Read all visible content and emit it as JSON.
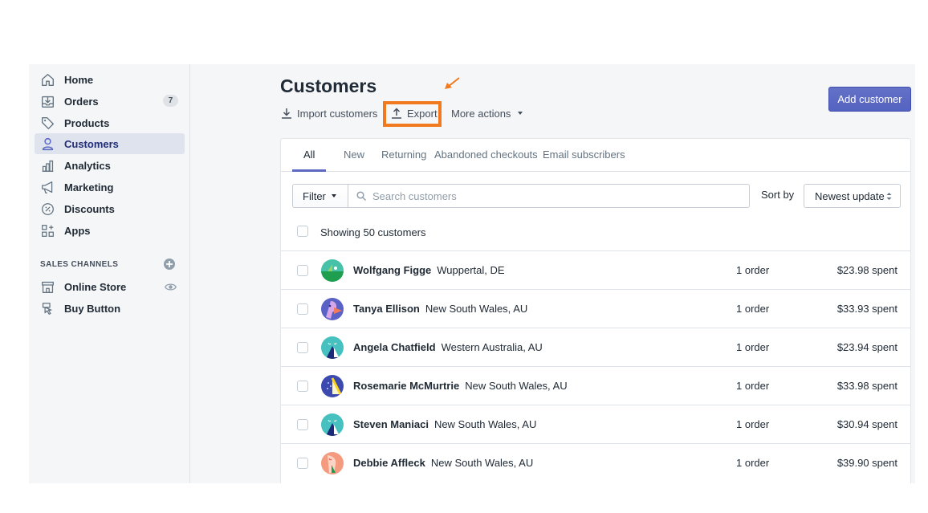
{
  "sidebar": {
    "items": [
      {
        "label": "Home",
        "icon": "home-icon"
      },
      {
        "label": "Orders",
        "icon": "orders-icon",
        "badge": "7"
      },
      {
        "label": "Products",
        "icon": "tag-icon"
      },
      {
        "label": "Customers",
        "icon": "person-icon",
        "active": true
      },
      {
        "label": "Analytics",
        "icon": "bar-chart-icon"
      },
      {
        "label": "Marketing",
        "icon": "megaphone-icon"
      },
      {
        "label": "Discounts",
        "icon": "discount-icon"
      },
      {
        "label": "Apps",
        "icon": "apps-icon"
      }
    ],
    "sales_channels_heading": "SALES CHANNELS",
    "channels": [
      {
        "label": "Online Store",
        "icon": "store-icon"
      },
      {
        "label": "Buy Button",
        "icon": "buy-button-icon"
      }
    ]
  },
  "header": {
    "title": "Customers",
    "import_label": "Import customers",
    "export_label": "Export",
    "more_actions_label": "More actions",
    "add_customer_label": "Add customer"
  },
  "tabs": [
    "All",
    "New",
    "Returning",
    "Abandoned checkouts",
    "Email subscribers"
  ],
  "filter": {
    "filter_label": "Filter",
    "search_placeholder": "Search customers",
    "sort_label": "Sort by",
    "sort_value": "Newest update"
  },
  "showing_text": "Showing 50 customers",
  "customers": [
    {
      "name": "Wolfgang Figge",
      "location": "Wuppertal, DE",
      "orders": "1 order",
      "spent": "$23.98 spent"
    },
    {
      "name": "Tanya Ellison",
      "location": "New South Wales, AU",
      "orders": "1 order",
      "spent": "$33.93 spent"
    },
    {
      "name": "Angela Chatfield",
      "location": "Western Australia, AU",
      "orders": "1 order",
      "spent": "$23.94 spent"
    },
    {
      "name": "Rosemarie McMurtrie",
      "location": "New South Wales, AU",
      "orders": "1 order",
      "spent": "$33.98 spent"
    },
    {
      "name": "Steven Maniaci",
      "location": "New South Wales, AU",
      "orders": "1 order",
      "spent": "$30.94 spent"
    },
    {
      "name": "Debbie Affleck",
      "location": "New South Wales, AU",
      "orders": "1 order",
      "spent": "$39.90 spent"
    }
  ],
  "colors": {
    "accent": "#5c6ac4",
    "highlight": "#f27a1e",
    "sidebar_active": "#dfe3ee"
  }
}
